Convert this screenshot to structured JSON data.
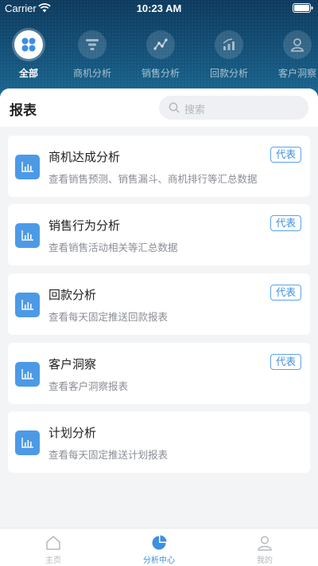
{
  "status": {
    "carrier": "Carrier",
    "time": "10:23 AM"
  },
  "topnav": {
    "items": [
      {
        "label": "全部",
        "icon": "grid-icon",
        "active": true
      },
      {
        "label": "商机分析",
        "icon": "funnel-icon",
        "active": false
      },
      {
        "label": "销售分析",
        "icon": "trend-icon",
        "active": false
      },
      {
        "label": "回款分析",
        "icon": "bar-growth-icon",
        "active": false
      },
      {
        "label": "客户洞察",
        "icon": "user-icon",
        "active": false
      }
    ]
  },
  "section": {
    "title": "报表"
  },
  "search": {
    "placeholder": "搜索"
  },
  "reports": [
    {
      "title": "商机达成分析",
      "desc": "查看销售预测、销售漏斗、商机排行等汇总数据",
      "tag": "代表"
    },
    {
      "title": "销售行为分析",
      "desc": "查看销售活动相关等汇总数据",
      "tag": "代表"
    },
    {
      "title": "回款分析",
      "desc": "查看每天固定推送回款报表",
      "tag": "代表"
    },
    {
      "title": "客户洞察",
      "desc": "查看客户洞察报表",
      "tag": "代表"
    },
    {
      "title": "计划分析",
      "desc": "查看每天固定推送计划报表",
      "tag": ""
    }
  ],
  "tabbar": {
    "items": [
      {
        "label": "主页",
        "icon": "home-icon"
      },
      {
        "label": "分析中心",
        "icon": "pie-chart-icon"
      },
      {
        "label": "我的",
        "icon": "person-icon"
      }
    ]
  },
  "colors": {
    "accent": "#3d8fe0",
    "header": "#14527c",
    "card_icon": "#4c9ae6"
  }
}
